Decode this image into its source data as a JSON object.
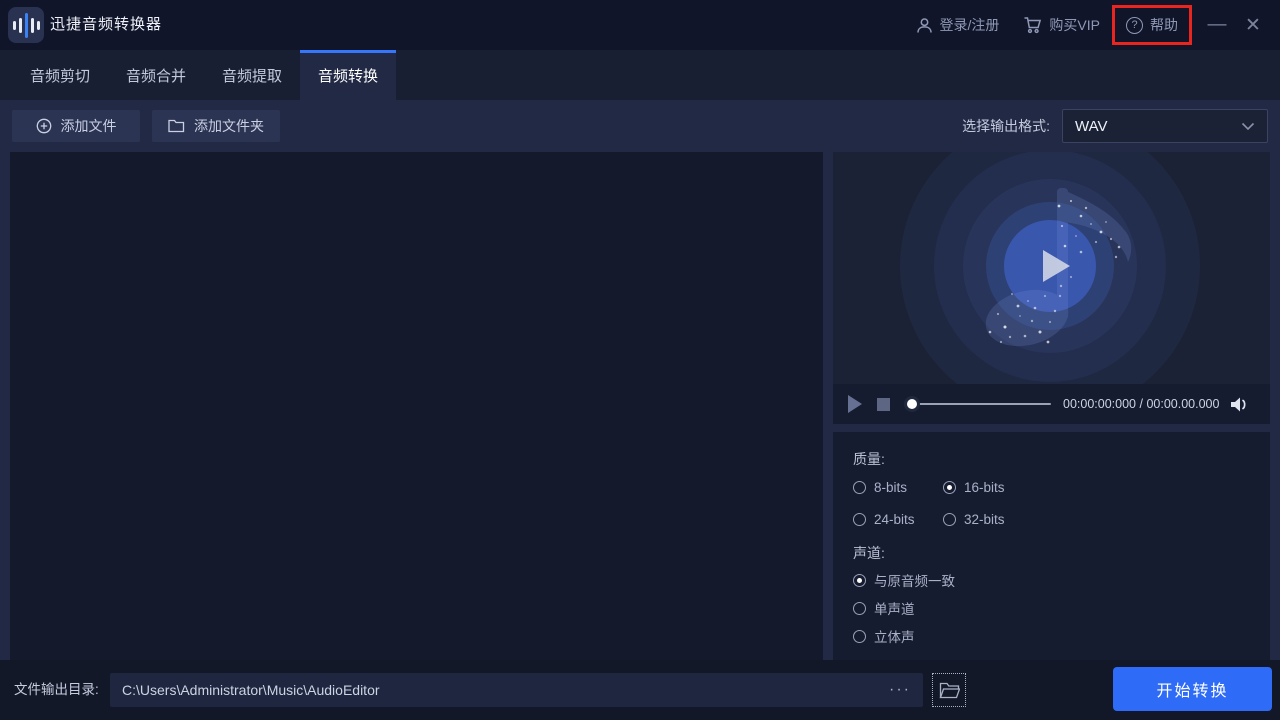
{
  "window": {
    "title": "迅捷音频转换器",
    "titlebar": {
      "login_label": "登录/注册",
      "vip_label": "购买VIP",
      "help_label": "帮助",
      "help_icon_glyph": "?",
      "minimize_glyph": "—",
      "close_glyph": "✕"
    }
  },
  "tabs": [
    {
      "label": "音频剪切",
      "active": false
    },
    {
      "label": "音频合并",
      "active": false
    },
    {
      "label": "音频提取",
      "active": false
    },
    {
      "label": "音频转换",
      "active": true
    }
  ],
  "toolbar": {
    "add_file_label": "添加文件",
    "add_folder_label": "添加文件夹",
    "output_format_label": "选择输出格式:",
    "output_format_value": "WAV"
  },
  "player": {
    "current_time": "00:00:00:000",
    "time_separator": "/",
    "total_time": "00:00.00.000",
    "progress_percent": 0
  },
  "settings": {
    "quality_label": "质量:",
    "quality_options": [
      {
        "label": "8-bits",
        "selected": false
      },
      {
        "label": "16-bits",
        "selected": true
      },
      {
        "label": "24-bits",
        "selected": false
      },
      {
        "label": "32-bits",
        "selected": false
      }
    ],
    "channel_label": "声道:",
    "channel_options": [
      {
        "label": "与原音频一致",
        "selected": true
      },
      {
        "label": "单声道",
        "selected": false
      },
      {
        "label": "立体声",
        "selected": false
      }
    ]
  },
  "footer": {
    "output_dir_label": "文件输出目录:",
    "output_dir_value": "C:\\Users\\Administrator\\Music\\AudioEditor",
    "more_dots": "···",
    "start_button_label": "开始转换"
  },
  "colors": {
    "accent_blue": "#2e6bf6",
    "tab_indicator": "#3576fd",
    "highlight_red": "#e8251f",
    "titlebar_bg": "#10152a",
    "panel_bg": "#161c2f"
  }
}
